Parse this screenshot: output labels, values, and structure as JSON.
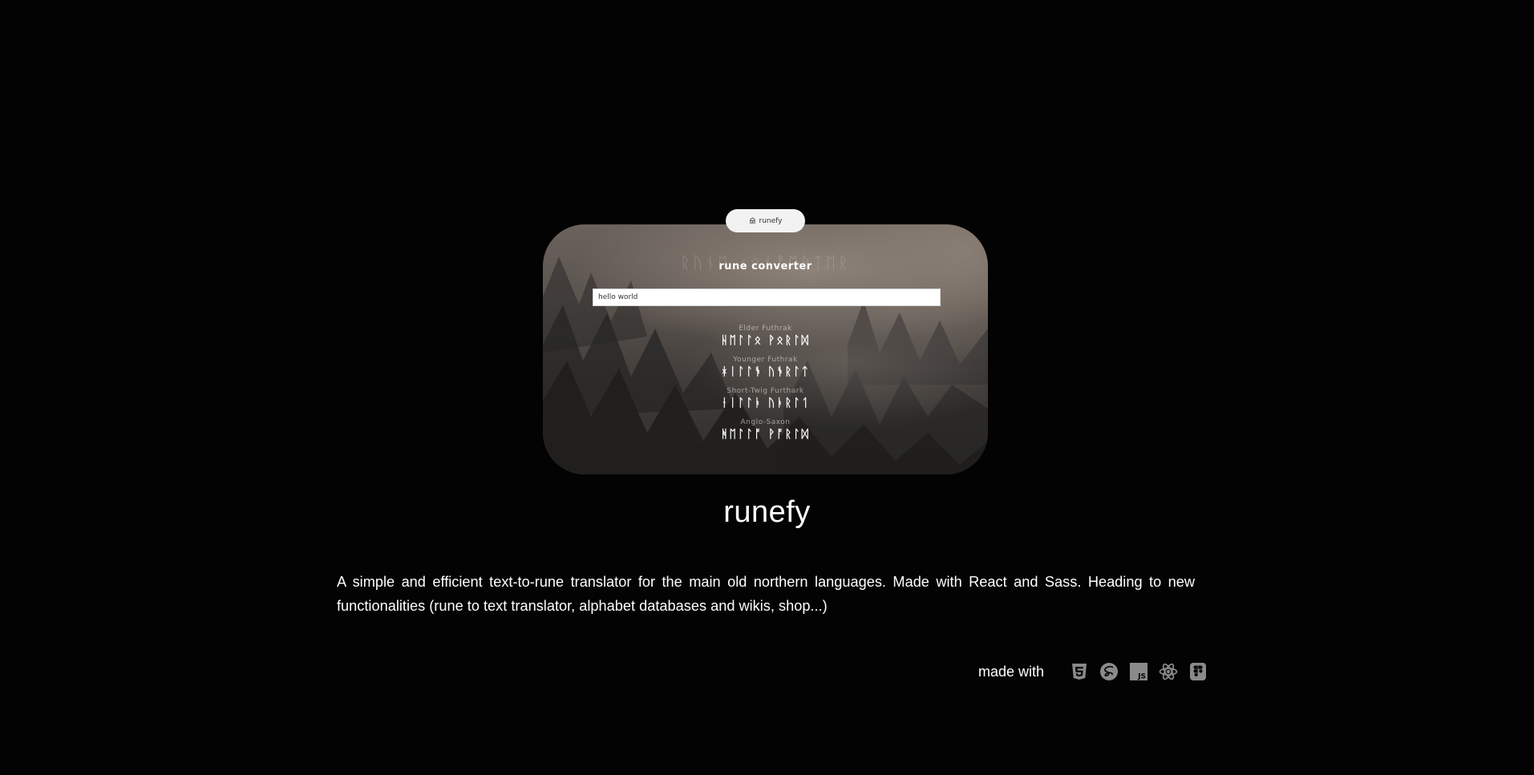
{
  "project": {
    "badge_label": "runefy",
    "title": "runefy",
    "description": "A simple and efficient text-to-rune translator for the main old northern languages. Made with React and Sass. Heading to new functionalities (rune to text translator, alphabet databases and wikis, shop...)",
    "made_with_label": "made with",
    "tech_icons": [
      "html5-icon",
      "sass-icon",
      "javascript-icon",
      "react-icon",
      "figma-icon"
    ]
  },
  "preview": {
    "background_runes": "ᚱᚢᚾᛖ ᚲᛟᚾᚡᛖᚱᛏᛖᚱ",
    "converter_title": "rune converter",
    "input_value": "hello world",
    "alphabets": [
      {
        "name": "Elder Futhrak",
        "runes": "ᚺᛖᛚᛚᛟ ᚹᛟᚱᛚᛞ"
      },
      {
        "name": "Younger Futhrak",
        "runes": "ᚼᛁᛚᛚᚬ ᚢᚬᚱᛚᛏ"
      },
      {
        "name": "Short-Twig Furthark",
        "runes": "ᚽᛁᛚᛚᚭ ᚢᚭᚱᛚᛐ"
      },
      {
        "name": "Anglo-Saxon",
        "runes": "ᚻᛖᛚᛚᚩ ᚹᚩᚱᛚᛞ"
      }
    ]
  },
  "colors": {
    "page_background": "#030303",
    "text": "#ffffff",
    "icon_gray": "#8a8a8a"
  }
}
